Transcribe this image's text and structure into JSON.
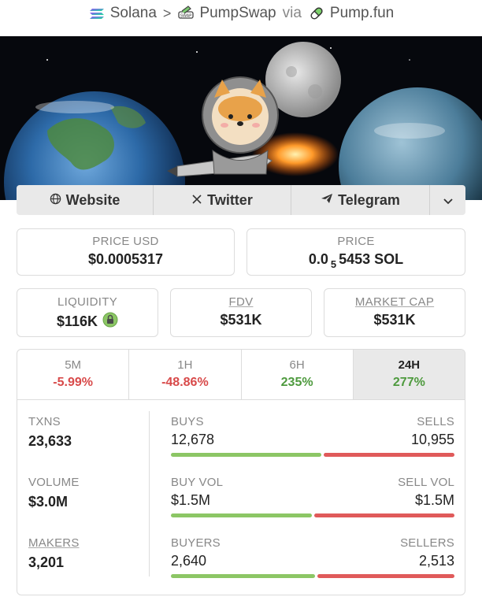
{
  "breadcrumb": {
    "chain": "Solana",
    "separator": ">",
    "dex": "PumpSwap",
    "via": "via",
    "launchpad": "Pump.fun"
  },
  "social": {
    "website": "Website",
    "twitter": "Twitter",
    "telegram": "Telegram"
  },
  "prices": {
    "price_usd_label": "PRICE USD",
    "price_usd": "$0.0005317",
    "price_label": "PRICE",
    "price_prefix": "0.0",
    "price_subscript": "5",
    "price_suffix": "5453 SOL"
  },
  "metrics": {
    "liquidity_label": "LIQUIDITY",
    "liquidity": "$116K",
    "fdv_label": "FDV",
    "fdv": "$531K",
    "mcap_label": "MARKET CAP",
    "mcap": "$531K"
  },
  "timeframes": [
    {
      "label": "5M",
      "change": "-5.99%",
      "direction": "neg"
    },
    {
      "label": "1H",
      "change": "-48.86%",
      "direction": "neg"
    },
    {
      "label": "6H",
      "change": "235%",
      "direction": "pos"
    },
    {
      "label": "24H",
      "change": "277%",
      "direction": "pos",
      "active": true
    }
  ],
  "left_stats": {
    "txns_label": "TXNS",
    "txns": "23,633",
    "volume_label": "VOLUME",
    "volume": "$3.0M",
    "makers_label": "MAKERS",
    "makers": "3,201"
  },
  "split_stats": {
    "buys_label": "BUYS",
    "buys": "12,678",
    "sells_label": "SELLS",
    "sells": "10,955",
    "buyvol_label": "BUY VOL",
    "buyvol": "$1.5M",
    "sellvol_label": "SELL VOL",
    "sellvol": "$1.5M",
    "buyers_label": "BUYERS",
    "buyers": "2,640",
    "sellers_label": "SELLERS",
    "sellers": "2,513"
  },
  "ratios": {
    "buys_fraction": 0.536,
    "buyvol_fraction": 0.5,
    "buyers_fraction": 0.512
  },
  "colors": {
    "positive": "#4e9a3e",
    "negative": "#d84a4a",
    "buy_bar": "#8cc665",
    "sell_bar": "#e05a5a",
    "solana_gradient": [
      "#9945ff",
      "#14f195"
    ]
  },
  "icons": [
    "solana-icon",
    "pumpswap-icon",
    "pill-icon",
    "globe-icon",
    "x-icon",
    "telegram-icon",
    "chevron-down-icon",
    "lock-icon"
  ]
}
